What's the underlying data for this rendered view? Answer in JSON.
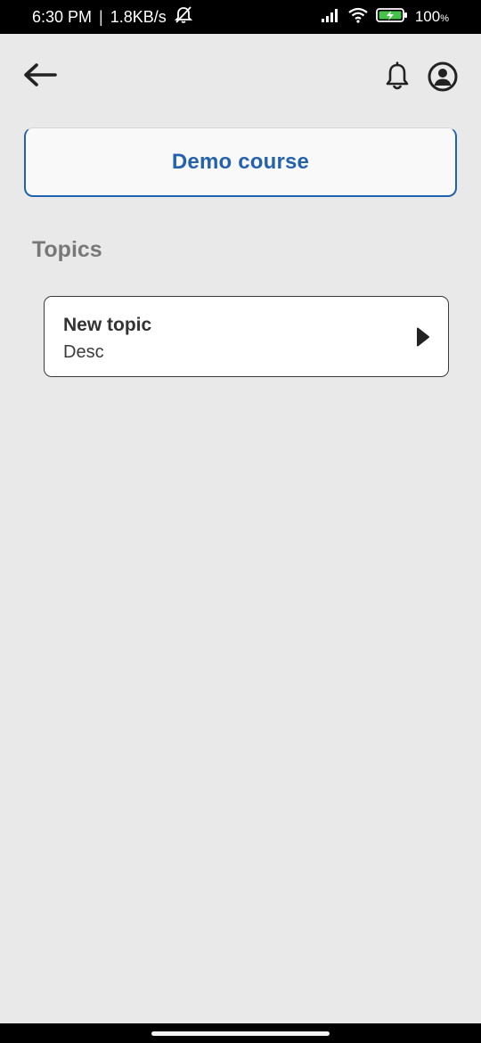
{
  "status_bar": {
    "time": "6:30 PM",
    "separator": "|",
    "network_speed": "1.8KB/s",
    "battery": "100",
    "battery_unit": "%",
    "icons": [
      "muted-bell-icon",
      "signal-icon",
      "wifi-icon",
      "battery-charging-icon"
    ]
  },
  "app_bar": {
    "back_icon": "back-arrow-icon",
    "notifications_icon": "bell-icon",
    "profile_icon": "account-circle-icon"
  },
  "course": {
    "title": "Demo course"
  },
  "topics_section": {
    "heading": "Topics",
    "items": [
      {
        "title": "New topic",
        "description": "Desc",
        "icon": "play-arrow-icon"
      }
    ]
  },
  "colors": {
    "accent": "#2462ad",
    "background": "#e9e9e9",
    "heading_gray": "#787878"
  }
}
